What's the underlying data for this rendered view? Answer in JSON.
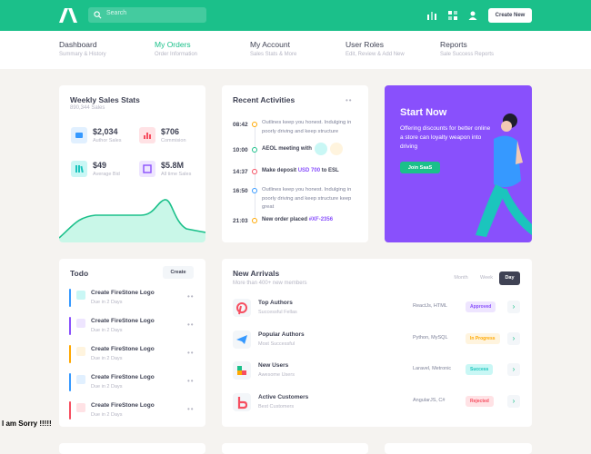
{
  "colors": {
    "brand": "#1bc08a",
    "dark": "#3f4254",
    "muted": "#b5b5c3",
    "purple": "#8950fc"
  },
  "header": {
    "search_placeholder": "Search",
    "create_label": "Create New",
    "icons": [
      "bar-chart-icon",
      "grid-icon",
      "user-icon"
    ]
  },
  "nav": [
    {
      "title": "Dashboard",
      "sub": "Summary & History"
    },
    {
      "title": "My Orders",
      "sub": "Order Information"
    },
    {
      "title": "My Account",
      "sub": "Sales Stats & More"
    },
    {
      "title": "User Roles",
      "sub": "Edit, Review & Add New"
    },
    {
      "title": "Reports",
      "sub": "Sale Success Reports"
    }
  ],
  "weekly": {
    "title": "Weekly Sales Stats",
    "sub": "890,344 Sales",
    "stats": [
      {
        "value": "$2,034",
        "label": "Author Sales",
        "icon": "chat-icon"
      },
      {
        "value": "$706",
        "label": "Commision",
        "icon": "bar-chart-icon"
      },
      {
        "value": "$49",
        "label": "Average Bid",
        "icon": "books-icon"
      },
      {
        "value": "$5.8M",
        "label": "All time Sales",
        "icon": "expand-icon"
      }
    ]
  },
  "activities": {
    "title": "Recent Activities",
    "items": [
      {
        "time": "08:42",
        "text": "Outlines keep you honest. Indulging in poorly driving and keep structure"
      },
      {
        "time": "10:00",
        "text": "AEOL meeting with"
      },
      {
        "time": "14:37",
        "text_pre": "Make deposit ",
        "highlight": "USD 700",
        "text_post": " to ESL"
      },
      {
        "time": "16:50",
        "text": "Outlines keep you honest. Indulging in poorly driving and keep structure keep great"
      },
      {
        "time": "21:03",
        "text": "New order placed ",
        "highlight": "#XF-2356"
      }
    ]
  },
  "promo": {
    "title": "Start Now",
    "desc": "Offering discounts for better online a store can loyalty weapon into driving",
    "button": "Join SaaS"
  },
  "todo": {
    "title": "Todo",
    "button": "Create",
    "items": [
      {
        "title": "Create FireStone Logo",
        "sub": "Due in 2 Days"
      },
      {
        "title": "Create FireStone Logo",
        "sub": "Due in 2 Days"
      },
      {
        "title": "Create FireStone Logo",
        "sub": "Due in 2 Days"
      },
      {
        "title": "Create FireStone Logo",
        "sub": "Due in 2 Days"
      },
      {
        "title": "Create FireStone Logo",
        "sub": "Due in 2 Days"
      }
    ]
  },
  "arrivals": {
    "title": "New Arrivals",
    "sub": "More than 400+ new members",
    "tabs": [
      "Month",
      "Week",
      "Day"
    ],
    "active_tab": "Day",
    "rows": [
      {
        "title": "Top Authors",
        "sub": "Successful Fellas",
        "tech": "ReactJs, HTML",
        "badge": "Approved"
      },
      {
        "title": "Popular Authors",
        "sub": "Most Successful",
        "tech": "Python, MySQL",
        "badge": "In Progress"
      },
      {
        "title": "New Users",
        "sub": "Awesome Users",
        "tech": "Laravel, Metronic",
        "badge": "Success"
      },
      {
        "title": "Active Customers",
        "sub": "Best Customers",
        "tech": "AngularJS, C#",
        "badge": "Rejected"
      }
    ]
  },
  "overlay_text": "I am Sorry !!!!!"
}
